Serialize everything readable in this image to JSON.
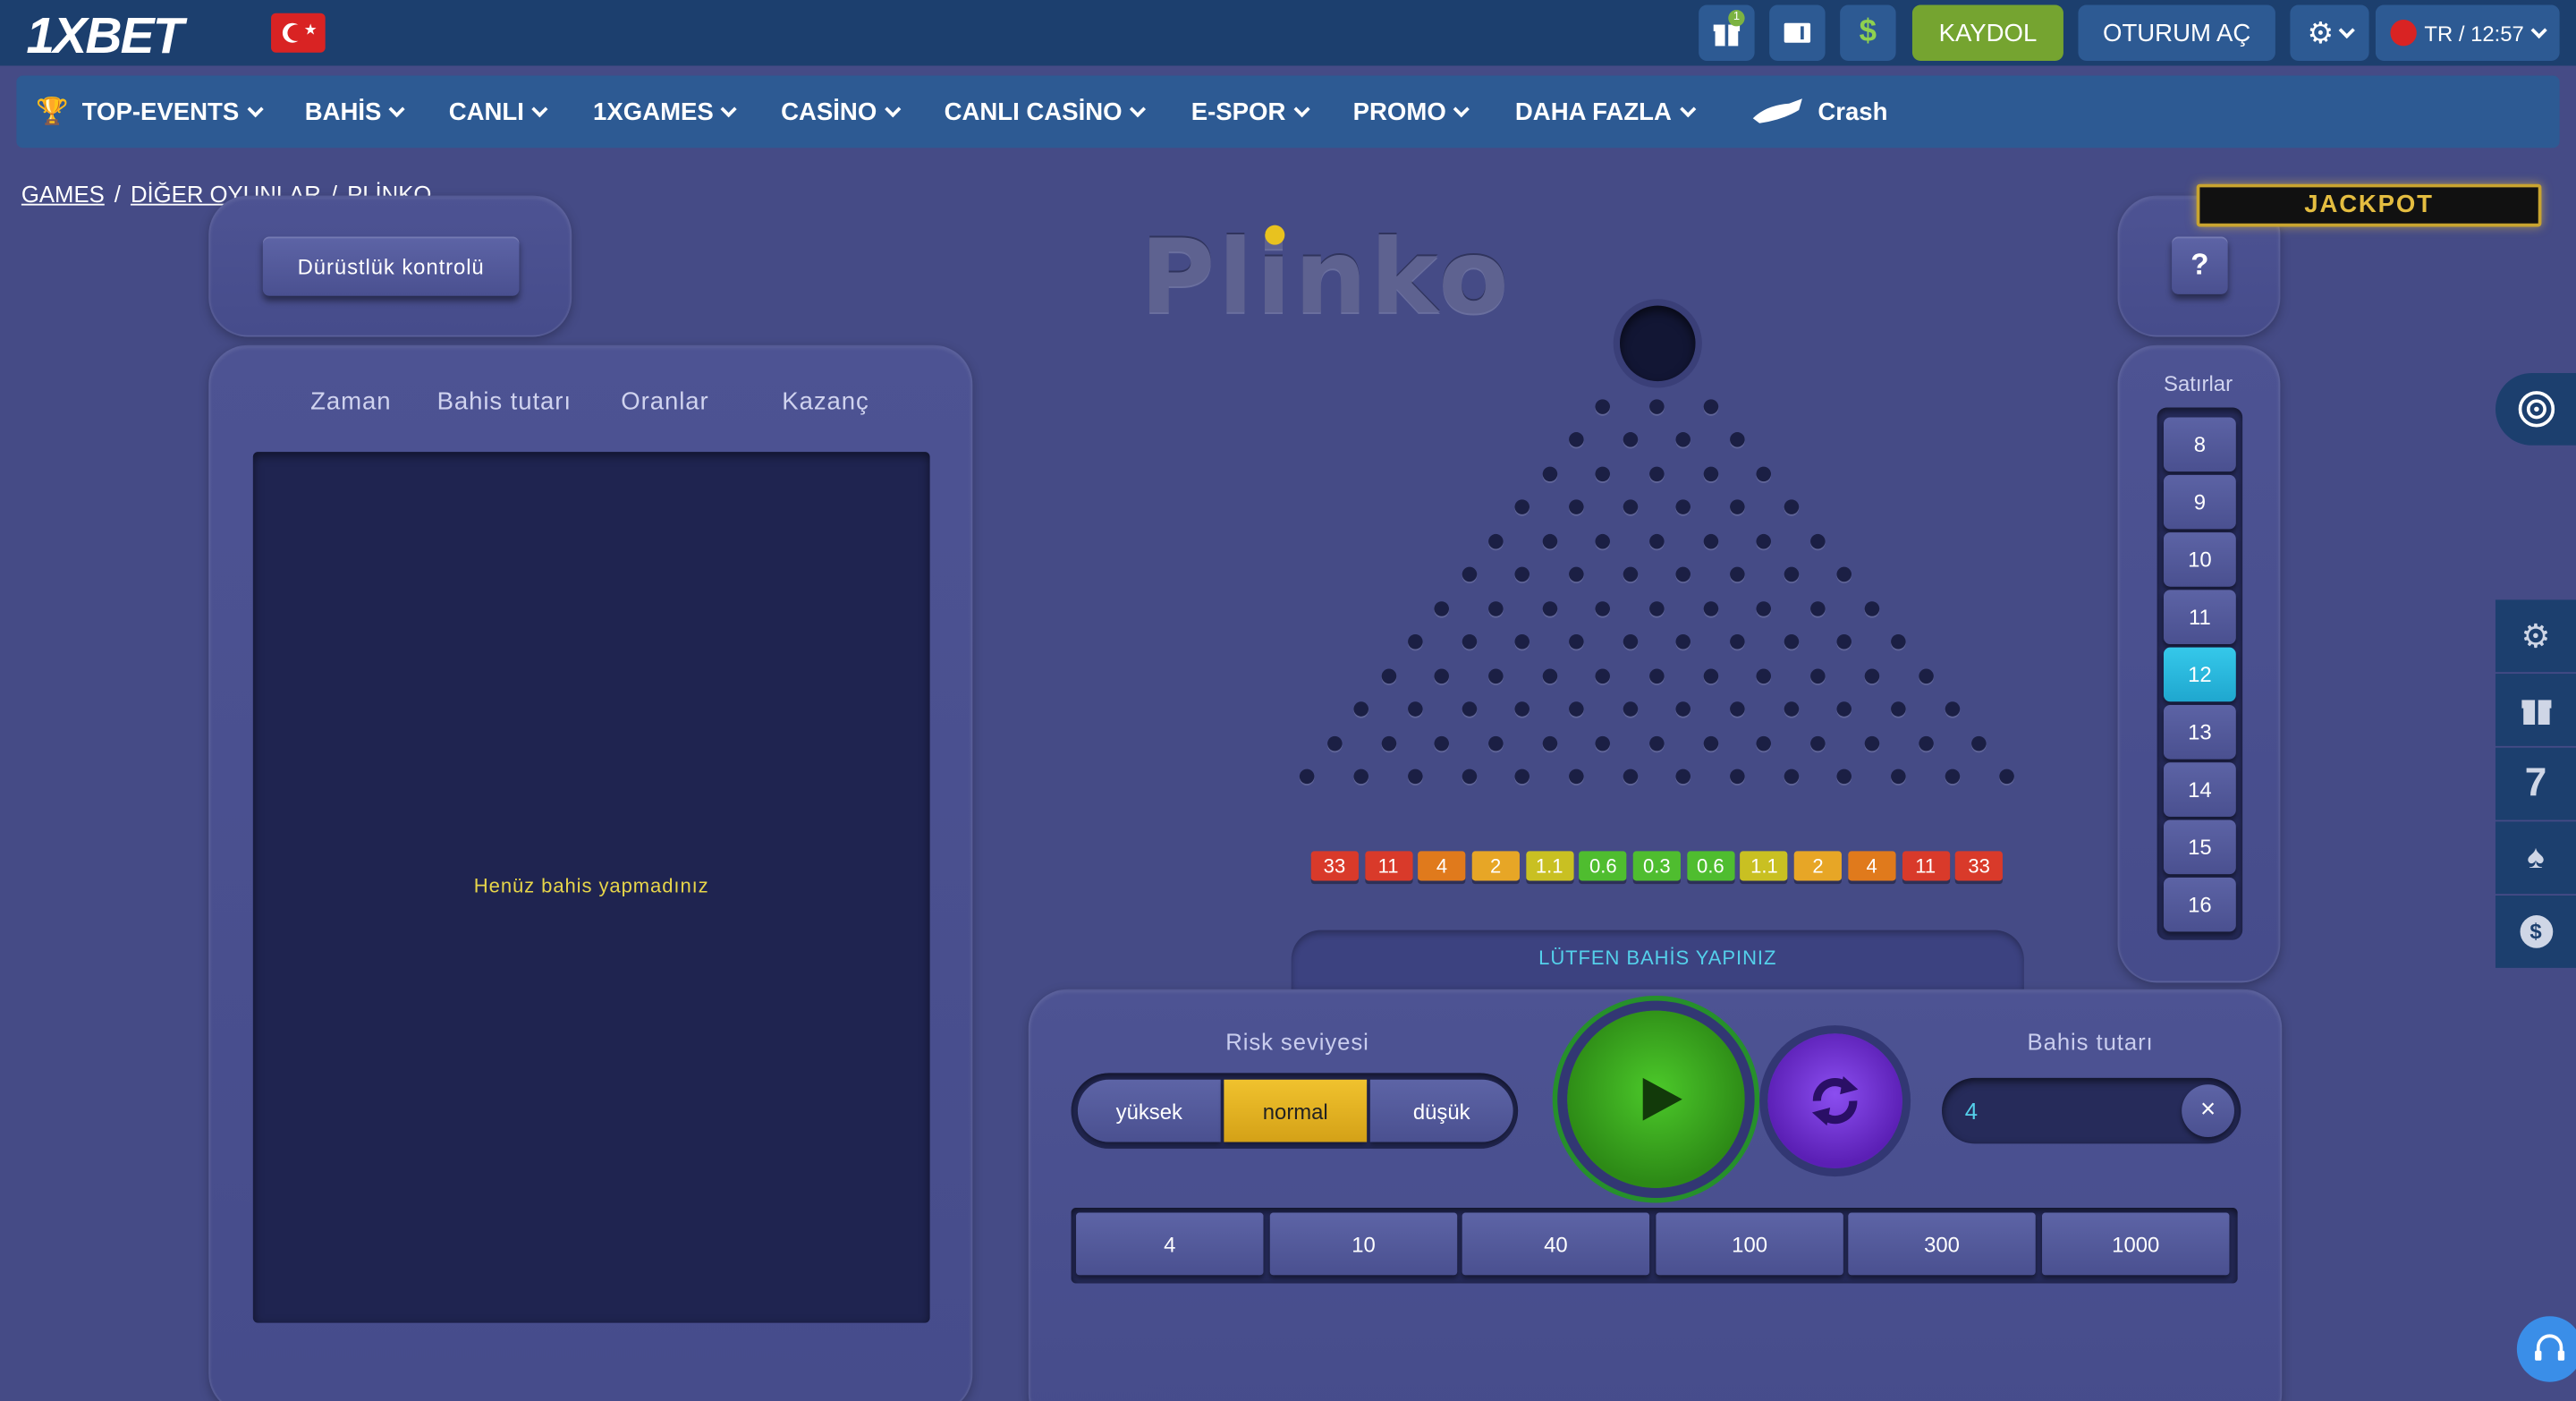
{
  "header": {
    "logo": "1XBET",
    "gift_badge": "1",
    "register_label": "KAYDOL",
    "login_label": "OTURUM AÇ",
    "lang_time": "TR / 12:57"
  },
  "nav": [
    {
      "label": "TOP-EVENTS",
      "icon": "trophy-icon"
    },
    {
      "label": "BAHİS"
    },
    {
      "label": "CANLI"
    },
    {
      "label": "1XGAMES"
    },
    {
      "label": "CASİNO"
    },
    {
      "label": "CANLI CASİNO"
    },
    {
      "label": "E-SPOR"
    },
    {
      "label": "PROMO"
    },
    {
      "label": "DAHA FAZLA"
    },
    {
      "label": "Crash",
      "icon": "plane-icon"
    }
  ],
  "breadcrumb": [
    "GAMES",
    "DİĞER OYUNLAR",
    "PLİNKO"
  ],
  "game": {
    "title": "Plinko",
    "fairness_button": "Dürüstlük kontrolü",
    "help_button": "?",
    "jackpot": "JACKPOT",
    "history": {
      "columns": [
        "Zaman",
        "Bahis tutarı",
        "Oranlar",
        "Kazanç"
      ],
      "empty_message": "Henüz bahis yapmadınız"
    },
    "multipliers": [
      "33",
      "11",
      "4",
      "2",
      "1.1",
      "0.6",
      "0.3",
      "0.6",
      "1.1",
      "2",
      "4",
      "11",
      "33"
    ],
    "status_message": "LÜTFEN BAHİS YAPINIZ",
    "rows": {
      "title": "Satırlar",
      "options": [
        "8",
        "9",
        "10",
        "11",
        "12",
        "13",
        "14",
        "15",
        "16"
      ],
      "selected": "12"
    },
    "risk": {
      "label": "Risk seviyesi",
      "options": [
        "yüksek",
        "normal",
        "düşük"
      ],
      "selected": "normal"
    },
    "bet": {
      "label": "Bahis tutarı",
      "value": "4",
      "quick_amounts": [
        "4",
        "10",
        "40",
        "100",
        "300",
        "1000"
      ]
    }
  },
  "colors": {
    "header_bg": "#1c3f6e",
    "nav_bg": "#2d5a93",
    "page_bg": "#454b86",
    "accent_cyan": "#35c8ea",
    "accent_gold": "#f0c22e",
    "register_green": "#75a430",
    "play_green": "#3fb323",
    "auto_purple": "#7a3ad9"
  }
}
